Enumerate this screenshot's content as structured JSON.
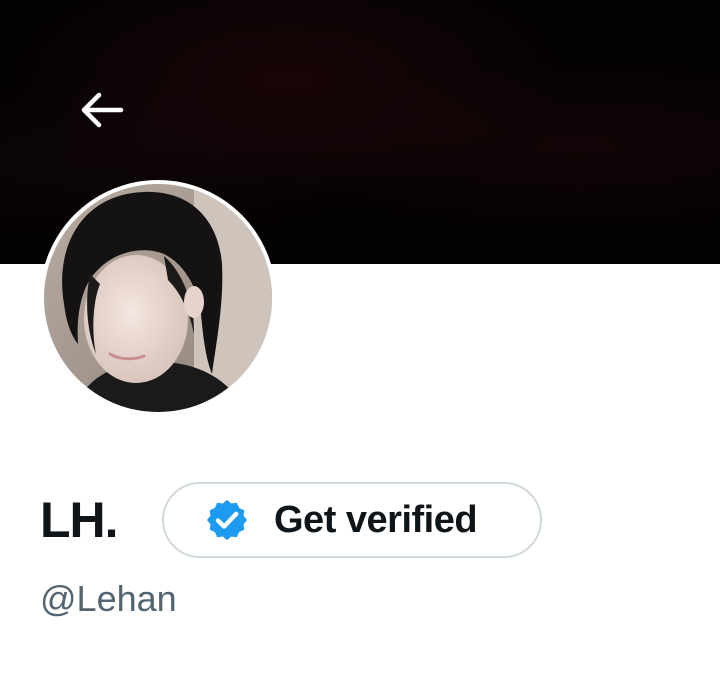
{
  "header": {
    "back_icon": "arrow-left-icon",
    "banner_color": "#050203"
  },
  "profile": {
    "display_name": "LH.",
    "handle": "@Lehan",
    "verify_button": {
      "label": "Get verified",
      "icon": "verified-badge-icon",
      "badge_color": "#1d9bf0"
    }
  }
}
